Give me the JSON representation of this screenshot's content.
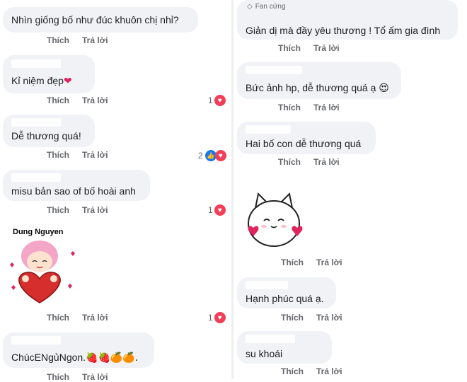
{
  "left": {
    "comments": [
      {
        "text": "Nhìn giống bố như đúc khuôn chị nhỉ?",
        "like": "Thích",
        "reply": "Trả lời",
        "reactions": ""
      },
      {
        "text": "Kỉ niệm đẹp",
        "emoji": "❤",
        "like": "Thích",
        "reply": "Trả lời",
        "reactions": "1"
      },
      {
        "text": "Dễ thương quá!",
        "like": "Thích",
        "reply": "Trả lời",
        "reactions": "2"
      },
      {
        "text": "misu bản sao of bố hoài anh",
        "like": "Thích",
        "reply": "Trả lời",
        "reactions": "1"
      },
      {
        "author": "Dung Nguyen",
        "like": "Thích",
        "reply": "Trả lời",
        "reactions": "1"
      },
      {
        "text": "ChúcENgủNgon.",
        "emoji": "🍓🍓🍊🍊.",
        "like": "Thích",
        "reply": "Trả lời"
      }
    ]
  },
  "right": {
    "fan_badge": "Fan cứng",
    "comments": [
      {
        "text": "Giản dị mà đầy yêu thương ! Tổ ấm gia đình",
        "like": "Thích",
        "reply": "Trả lời"
      },
      {
        "text": "Bức ảnh hp, dễ thương quá ạ",
        "emoji": "😍",
        "like": "Thích",
        "reply": "Trả lời"
      },
      {
        "text": "Hai bố con dễ thương quá",
        "like": "Thích",
        "reply": "Trả lời"
      },
      {
        "like": "Thích",
        "reply": "Trả lời"
      },
      {
        "text": "Hạnh phúc quá ạ.",
        "like": "Thích",
        "reply": "Trả lời"
      },
      {
        "text": "su khoái",
        "like": "Thích",
        "reply": "Trả lời"
      }
    ]
  },
  "colors": {
    "bubble": "#f0f2f5",
    "heart": "#f33e58",
    "like": "#1877f2",
    "meta": "#65676b"
  }
}
